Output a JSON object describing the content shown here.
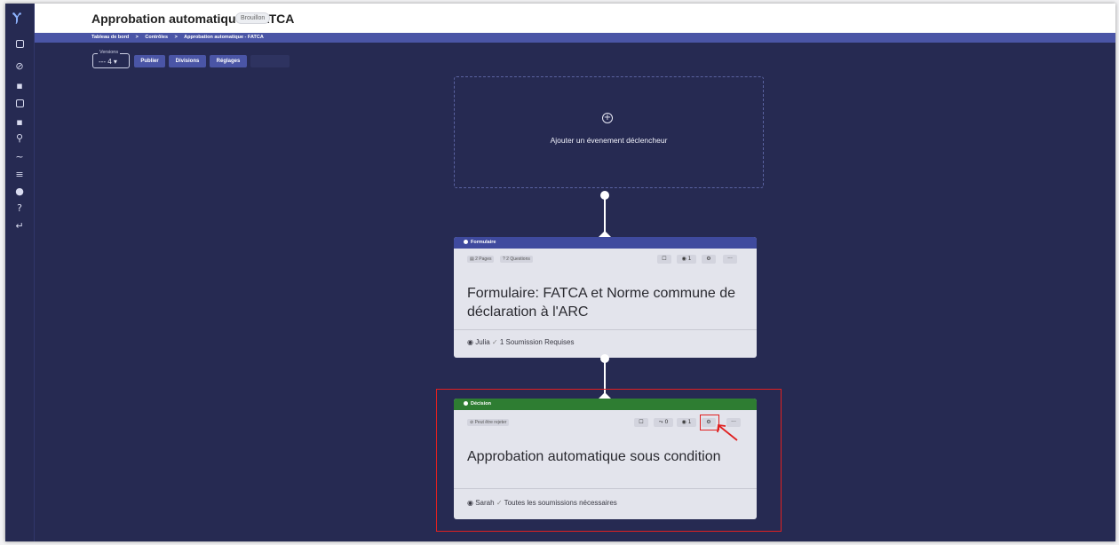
{
  "header": {
    "title": "Approbation automatique - FATCA",
    "status_badge": "Brouillon"
  },
  "breadcrumb": [
    "Tableau de bord",
    "Contrôles",
    "Approbation automatique - FATCA"
  ],
  "breadcrumb_separator": ">",
  "toolbar": {
    "version_label": "Versions",
    "version_value": "--- 4 ▾",
    "publish_label": "Publier",
    "divisions_label": "Divisions",
    "settings_label": "Réglages"
  },
  "sidebar": {
    "icons": [
      "app-logo",
      "dashboard-icon",
      "check-circle-icon",
      "chat-icon",
      "image-icon",
      "copy-icon",
      "search-icon",
      "trend-icon",
      "sliders-icon",
      "chart-icon",
      "help-icon",
      "return-icon"
    ]
  },
  "trigger": {
    "label": "Ajouter un évenement déclencheur"
  },
  "form_card": {
    "header_label": "Formulaire",
    "header_color": "#3f4a9e",
    "chip_pages": "2 Pages",
    "chip_questions": "2 Questions",
    "assignee_count": "1",
    "title": "Formulaire: FATCA et Norme commune de déclaration à l'ARC",
    "footer_user": "Julia",
    "footer_requirement": "1 Soumission Requises"
  },
  "decision_card": {
    "header_label": "Décision",
    "header_color": "#2e7d32",
    "chip_reject": "Peut être rejeter",
    "branch_count": "0",
    "assignee_count": "1",
    "title": "Approbation automatique sous condition",
    "footer_user": "Sarah",
    "footer_requirement": "Toutes les soumissions nécessaires"
  },
  "colors": {
    "background": "#262a52",
    "accent": "#4a55a6",
    "highlight": "#e02020"
  }
}
